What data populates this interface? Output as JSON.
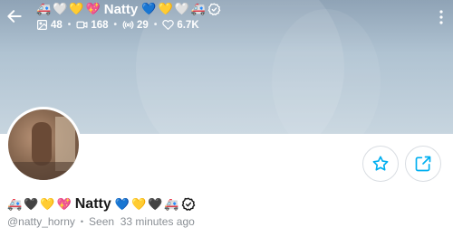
{
  "header": {
    "name": "Natty",
    "emojis_before": [
      "🚑",
      "🤍",
      "💛",
      "💖"
    ],
    "emojis_after": [
      "💙",
      "💛",
      "🤍",
      "🚑"
    ],
    "stats": {
      "photos": "48",
      "videos": "168",
      "streams": "29",
      "likes": "6.7K"
    }
  },
  "profile": {
    "name": "Natty",
    "emojis_before": [
      "🚑",
      "🖤",
      "💛",
      "💖"
    ],
    "emojis_after": [
      "💙",
      "💛",
      "🖤",
      "🚑"
    ],
    "username": "@natty_horny",
    "last_seen": "Seen  33 minutes ago"
  },
  "icons": {
    "back": "arrow-left-icon",
    "menu": "more-vertical-icon",
    "verified": "verified-check-icon",
    "favorite": "star-icon",
    "share": "share-icon"
  },
  "colors": {
    "accent": "#00aff0",
    "banner": "#b0c3d2",
    "muted_text": "#8a8f95"
  }
}
